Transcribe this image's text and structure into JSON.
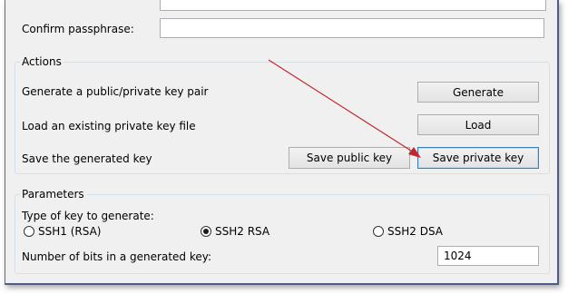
{
  "confirm": {
    "label": "Confirm passphrase:",
    "value": ""
  },
  "actions": {
    "title": "Actions",
    "generate_text": "Generate a public/private key pair",
    "generate_button": "Generate",
    "load_text": "Load an existing private key file",
    "load_button": "Load",
    "save_text": "Save the generated key",
    "save_public_button": "Save public key",
    "save_private_button": "Save private key"
  },
  "parameters": {
    "title": "Parameters",
    "key_type_label": "Type of key to generate:",
    "key_types": [
      {
        "label": "SSH1 (RSA)",
        "checked": false
      },
      {
        "label": "SSH2 RSA",
        "checked": true
      },
      {
        "label": "SSH2 DSA",
        "checked": false
      }
    ],
    "bits_label": "Number of bits in a generated key:",
    "bits_value": "1024"
  },
  "annotation": {
    "arrow_color": "#c0282d"
  }
}
